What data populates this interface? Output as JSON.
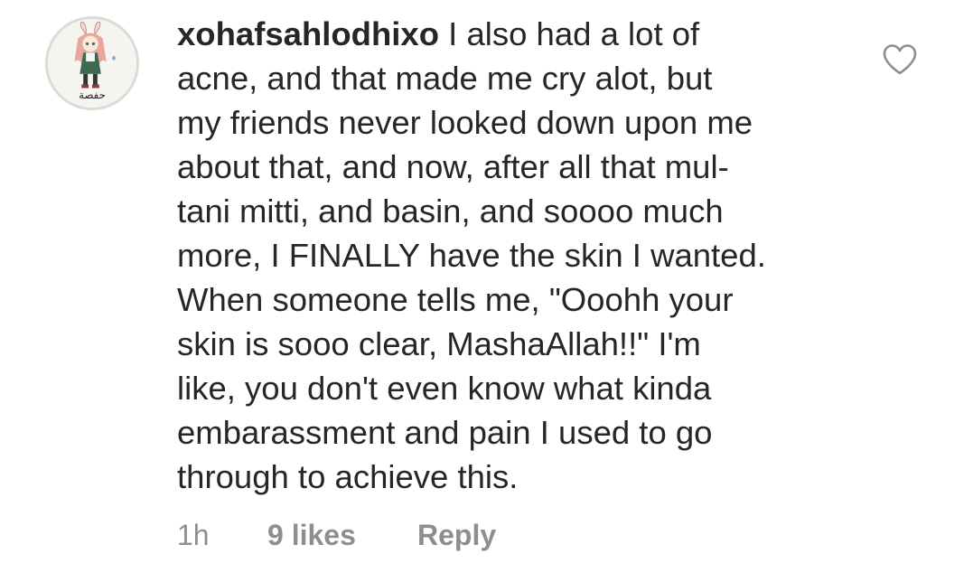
{
  "comment": {
    "username": "xohafsahlodhixo",
    "text_lines": [
      "I also had a lot of",
      "acne, and that made me cry alot, but",
      "my friends never looked down upon me",
      "about that, and now, after all that mul-",
      "tani mitti, and basin, and soooo much",
      "more, I FINALLY have the skin I wanted.",
      "When someone tells me, \"Ooohh your",
      "skin is sooo clear, MashaAllah!!\" I'm",
      "like, you don't even know what kinda",
      "embarassment and pain I used to go",
      "through to achieve this."
    ],
    "time": "1h",
    "likes": "9 likes",
    "reply_label": "Reply",
    "avatar_caption": "حفصة"
  },
  "icons": {
    "like": "heart-outline-icon"
  },
  "colors": {
    "text": "#262626",
    "meta": "#8e8e8e",
    "avatar_border": "#dbdbdb"
  }
}
